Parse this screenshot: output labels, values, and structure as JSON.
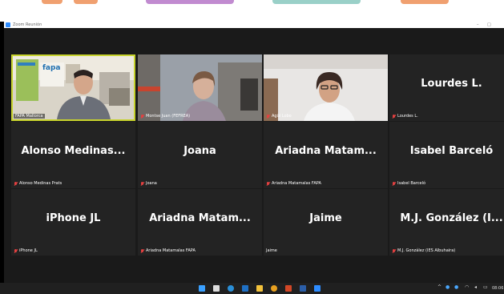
{
  "window": {
    "title": "Zoom Reunión"
  },
  "participants": [
    {
      "name": "FAPA Mallorca",
      "video": true,
      "active": true,
      "muted": false
    },
    {
      "name": "Montse Juan (FEFREA)",
      "video": true,
      "muted": true
    },
    {
      "name": "Agüí Lobo",
      "video": true,
      "muted": true
    },
    {
      "display": "Lourdes L.",
      "name": "Lourdes L.",
      "muted": true
    },
    {
      "display": "Alonso Medinas...",
      "name": "Alonso Medinas Prats",
      "muted": true
    },
    {
      "display": "Joana",
      "name": "Joana",
      "muted": true
    },
    {
      "display": "Ariadna Matam...",
      "name": "Ariadna Matamalas FAPA",
      "muted": true
    },
    {
      "display": "Isabel Barceló",
      "name": "Isabel Barceló",
      "muted": true
    },
    {
      "display": "iPhone JL",
      "name": "iPhone JL",
      "muted": true
    },
    {
      "display": "Ariadna Matam...",
      "name": "Ariadna Matamalas FAPA",
      "muted": true
    },
    {
      "display": "Jaime",
      "name": "Jaime",
      "muted": false
    },
    {
      "display": "M.J. González (I...",
      "name": "M.J. González (IES Albuhaira)",
      "muted": true
    }
  ],
  "background_video": {
    "banner_text": "fapa"
  },
  "taskbar": {
    "time": "08:06"
  },
  "colors": {
    "active_border": "#c7d32d",
    "tile": "#232323",
    "mute": "#e34040"
  }
}
